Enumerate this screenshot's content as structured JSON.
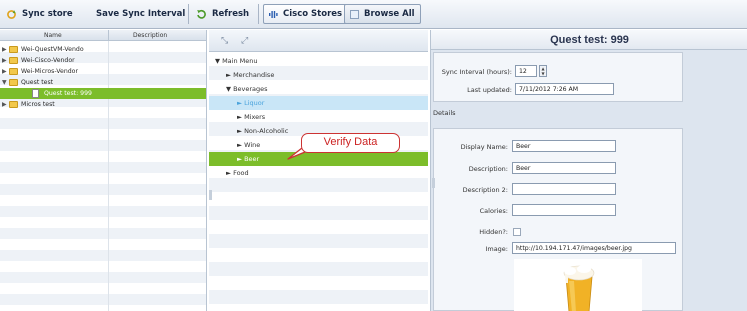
{
  "toolbar": {
    "sync_store_label": "Sync store",
    "save_sync_interval_label": "Save Sync Interval",
    "refresh_label": "Refresh",
    "cisco_stores_label": "Cisco Stores",
    "browse_all_label": "Browse All"
  },
  "stores_panel": {
    "columns": [
      "Name",
      "Description"
    ],
    "items": [
      {
        "label": "Wei-QuestVM-Vendo",
        "type": "folder",
        "expanded": false
      },
      {
        "label": "Wei-Cisco-Vendor",
        "type": "folder",
        "expanded": false
      },
      {
        "label": "Wei-Micros-Vendor",
        "type": "folder",
        "expanded": false
      },
      {
        "label": "Quest test",
        "type": "folder",
        "expanded": true
      },
      {
        "label": "Quest test: 999",
        "type": "document",
        "selected": true
      },
      {
        "label": "Micros test",
        "type": "folder",
        "expanded": false
      }
    ]
  },
  "menu_panel": {
    "items": [
      {
        "label": "▼ Main Menu"
      },
      {
        "label": "► Merchandise"
      },
      {
        "label": "▼ Beverages"
      },
      {
        "label": "► Liquor",
        "highlighted": true
      },
      {
        "label": "► Mixers"
      },
      {
        "label": "► Non-Alcoholic"
      },
      {
        "label": "► Wine"
      },
      {
        "label": "► Beer",
        "selected": true
      },
      {
        "label": "► Food"
      }
    ],
    "callout_text": "Verify Data"
  },
  "detail_panel": {
    "title": "Quest test: 999",
    "sync_interval_label": "Sync Interval (hours):",
    "sync_interval_value": "12",
    "last_updated_label": "Last updated:",
    "last_updated_value": "7/11/2012 7:26 AM",
    "details_section_label": "Details",
    "display_name_label": "Display Name:",
    "display_name_value": "Beer",
    "description_label": "Description:",
    "description_value": "Beer",
    "description2_label": "Description 2:",
    "description2_value": "",
    "calories_label": "Calories:",
    "calories_value": "",
    "hidden_label": "Hidden?:",
    "hidden_checked": false,
    "image_label": "Image:",
    "image_value": "http://10.194.171.47/images/beer.jpg"
  },
  "colors": {
    "selection_green": "#7cbd2a",
    "hover_blue": "#c9e6f7",
    "callout_red": "#cc2222"
  }
}
